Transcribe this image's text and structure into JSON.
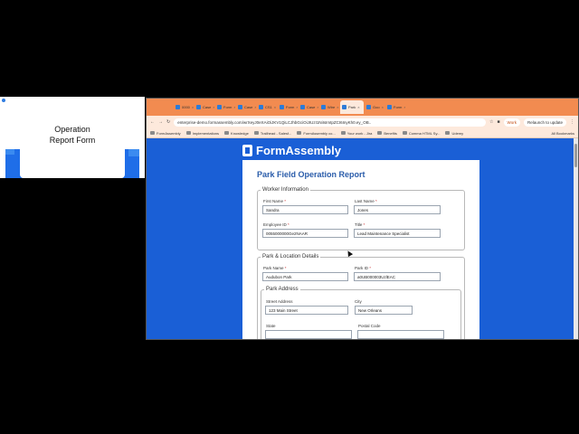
{
  "slide": {
    "title": "Operation\nReport Form"
  },
  "browser": {
    "tabs": [
      {
        "label": "0000"
      },
      {
        "label": "Case"
      },
      {
        "label": "Form"
      },
      {
        "label": "Case"
      },
      {
        "label": "CS1"
      },
      {
        "label": "Form"
      },
      {
        "label": "Case"
      },
      {
        "label": "Wire"
      },
      {
        "label": "Park",
        "active": true
      },
      {
        "label": "Goo"
      },
      {
        "label": "Form"
      }
    ],
    "url": "enterprise-demo.formassembly.com/wrXeyJ0eXAiOiJKV1QiLCJhbGciOiJIUzI1NiIsImtpZCI6InyKh0.ey_OB..",
    "work_label": "Work",
    "relaunch_label": "Relaunch to update",
    "bookmarks": [
      "FormAssembly",
      "Implementations",
      "Knowledge",
      "Trailhead - Salesf...",
      "FormAssembly co...",
      "Your work - Jira",
      "Benefits",
      "Comma HTML Sy...",
      "Udemy"
    ],
    "all_bookmarks": "All Bookmarks"
  },
  "brand": {
    "name": "FormAssembly",
    "accent": "#1a5fd6"
  },
  "form": {
    "title": "Park Field Operation Report",
    "worker_section": "Worker Information",
    "first_name_label": "First Name",
    "first_name_value": "Sandra",
    "last_name_label": "Last Name",
    "last_name_value": "Jones",
    "employee_id_label": "Employee ID",
    "employee_id_value": "0055000000Ge2NAAR",
    "title_label": "Title",
    "title_value": "Lead Maintenance Specialist",
    "park_section": "Park & Location Details",
    "park_name_label": "Park Name",
    "park_name_value": "Audubon Park",
    "park_id_label": "Park ID",
    "park_id_value": "a0UB000003UzlEAC",
    "address_section": "Park Address",
    "street_label": "Street Address",
    "street_value": "123 Main Street",
    "city_label": "City",
    "city_value": "New Orleans",
    "state_label": "State",
    "postal_label": "Postal Code",
    "required_mark": "*"
  }
}
